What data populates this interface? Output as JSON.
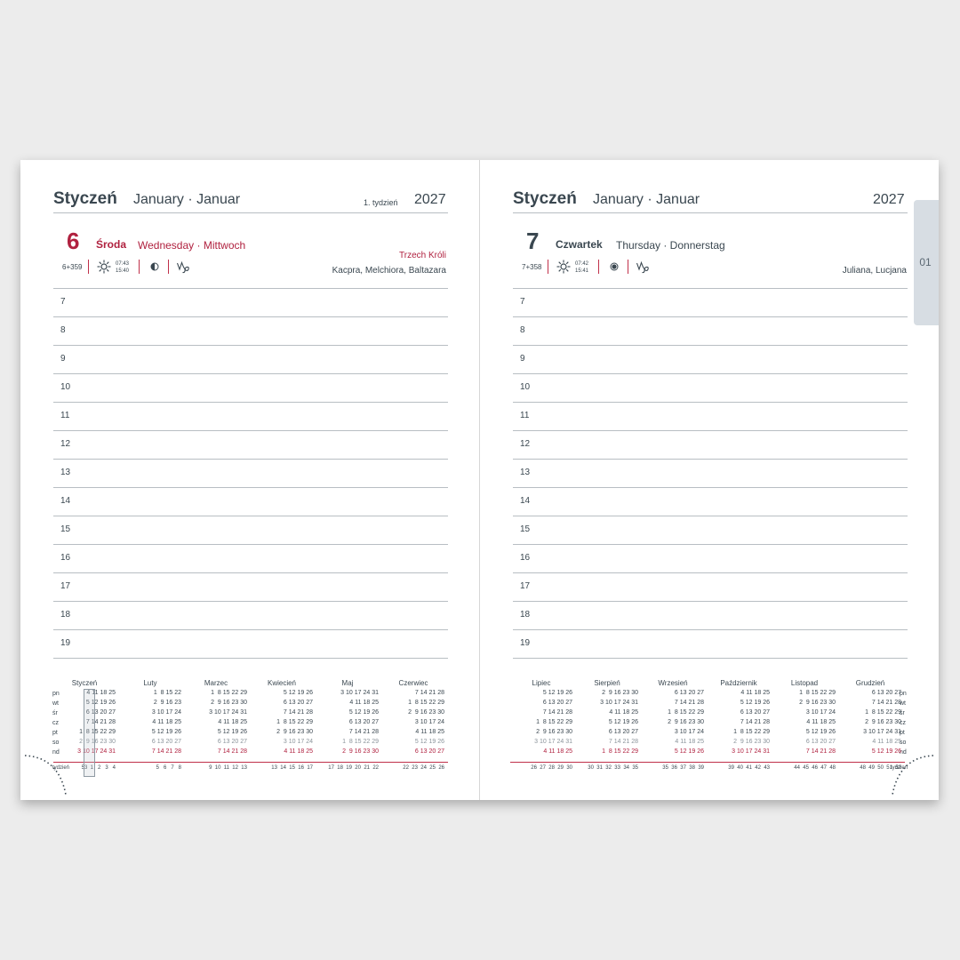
{
  "left_page": {
    "month_pl": "Styczeń",
    "month_en_de": "January · Januar",
    "week_label": "1. tydzień",
    "year": "2027",
    "day_number": "6",
    "day_name_pl": "Środa",
    "day_name_en_de": "Wednesday · Mittwoch",
    "holiday": "Trzech Króli",
    "name_days": "Kacpra, Melchiora, Baltazara",
    "day_counter": "6+359",
    "sunrise": "07:43",
    "sunset": "15:40",
    "moon_icon": "first-quarter-moon-icon",
    "zodiac_icon": "capricorn-icon",
    "hours": [
      "7",
      "8",
      "9",
      "10",
      "11",
      "12",
      "13",
      "14",
      "15",
      "16",
      "17",
      "18",
      "19"
    ],
    "weekday_labels": [
      "pn",
      "wt",
      "śr",
      "cz",
      "pt",
      "so",
      "nd"
    ],
    "week_row_label": "tydzień",
    "mini_months": [
      {
        "name": "Styczeń",
        "rows": [
          "    4 11 18 25",
          "    5 12 19 26",
          "    6 13 20 27",
          "    7 14 21 28",
          "1  8 15 22 29",
          "2  9 16 23 30",
          "3 10 17 24 31"
        ],
        "weeks": "53  1   2   3   4"
      },
      {
        "name": "Luty",
        "rows": [
          "1  8 15 22",
          "2  9 16 23",
          "3 10 17 24",
          "4 11 18 25",
          "5 12 19 26",
          "6 13 20 27",
          "7 14 21 28"
        ],
        "weeks": "5   6   7   8"
      },
      {
        "name": "Marzec",
        "rows": [
          "1  8 15 22 29",
          "2  9 16 23 30",
          "3 10 17 24 31",
          "4 11 18 25",
          "5 12 19 26",
          "6 13 20 27",
          "7 14 21 28"
        ],
        "weeks": "9  10  11  12  13"
      },
      {
        "name": "Kwiecień",
        "rows": [
          "    5 12 19 26",
          "    6 13 20 27",
          "    7 14 21 28",
          "1  8 15 22 29",
          "2  9 16 23 30",
          "3 10 17 24",
          "4 11 18 25"
        ],
        "weeks": "13  14  15  16  17"
      },
      {
        "name": "Maj",
        "rows": [
          "3 10 17 24 31",
          "4 11 18 25",
          "5 12 19 26",
          "6 13 20 27",
          "7 14 21 28",
          "1  8 15 22 29",
          "2  9 16 23 30"
        ],
        "weeks": "17  18  19  20  21  22"
      },
      {
        "name": "Czerwiec",
        "rows": [
          "    7 14 21 28",
          "1  8 15 22 29",
          "2  9 16 23 30",
          "3 10 17 24",
          "4 11 18 25",
          "5 12 19 26",
          "6 13 20 27"
        ],
        "weeks": "22  23  24  25  26"
      }
    ]
  },
  "right_page": {
    "month_pl": "Styczeń",
    "month_en_de": "January · Januar",
    "year": "2027",
    "day_number": "7",
    "day_name_pl": "Czwartek",
    "day_name_en_de": "Thursday · Donnerstag",
    "name_days": "Juliana, Lucjana",
    "day_counter": "7+358",
    "sunrise": "07:42",
    "sunset": "15:41",
    "moon_icon": "full-moon-icon",
    "zodiac_icon": "capricorn-icon",
    "hours": [
      "7",
      "8",
      "9",
      "10",
      "11",
      "12",
      "13",
      "14",
      "15",
      "16",
      "17",
      "18",
      "19"
    ],
    "weekday_labels": [
      "pn",
      "wt",
      "śr",
      "cz",
      "pt",
      "so",
      "nd"
    ],
    "week_row_label": "tydzień",
    "mini_months": [
      {
        "name": "Lipiec",
        "rows": [
          "    5 12 19 26",
          "    6 13 20 27",
          "    7 14 21 28",
          "1  8 15 22 29",
          "2  9 16 23 30",
          "3 10 17 24 31",
          "4 11 18 25"
        ],
        "weeks": "26  27  28  29  30"
      },
      {
        "name": "Sierpień",
        "rows": [
          "2  9 16 23 30",
          "3 10 17 24 31",
          "4 11 18 25",
          "5 12 19 26",
          "6 13 20 27",
          "7 14 21 28",
          "1  8 15 22 29"
        ],
        "weeks": "30  31  32  33  34  35"
      },
      {
        "name": "Wrzesień",
        "rows": [
          "    6 13 20 27",
          "    7 14 21 28",
          "1  8 15 22 29",
          "2  9 16 23 30",
          "3 10 17 24",
          "4 11 18 25",
          "5 12 19 26"
        ],
        "weeks": "35  36  37  38  39"
      },
      {
        "name": "Październik",
        "rows": [
          "    4 11 18 25",
          "    5 12 19 26",
          "    6 13 20 27",
          "    7 14 21 28",
          "1  8 15 22 29",
          "2  9 16 23 30",
          "3 10 17 24 31"
        ],
        "weeks": "39  40  41  42  43"
      },
      {
        "name": "Listopad",
        "rows": [
          "1  8 15 22 29",
          "2  9 16 23 30",
          "3 10 17 24",
          "4 11 18 25",
          "5 12 19 26",
          "6 13 20 27",
          "7 14 21 28"
        ],
        "weeks": "44  45  46  47  48"
      },
      {
        "name": "Grudzień",
        "rows": [
          "    6 13 20 27",
          "    7 14 21 28",
          "1  8 15 22 29",
          "2  9 16 23 30",
          "3 10 17 24 31",
          "4 11 18 25",
          "5 12 19 26"
        ],
        "weeks": "48  49  50  51  52"
      }
    ]
  },
  "tab_label": "01"
}
